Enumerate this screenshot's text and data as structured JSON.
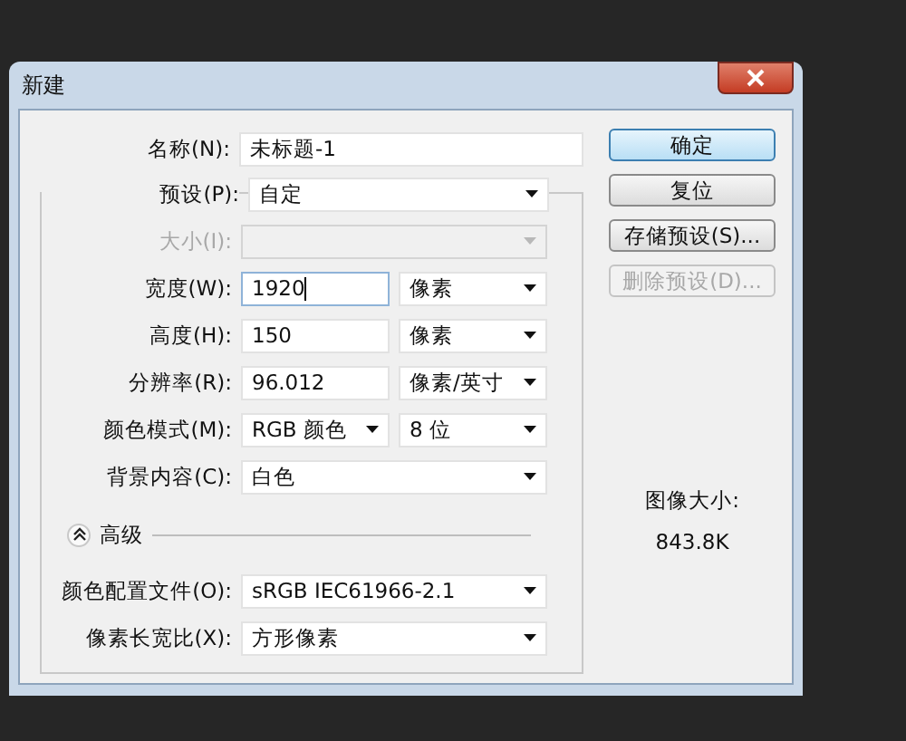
{
  "window": {
    "title": "新建"
  },
  "name": {
    "label": "名称(N):",
    "value": "未标题-1"
  },
  "preset": {
    "label": "预设(P):",
    "value": "自定"
  },
  "rows": [
    {
      "label": "大小(I):",
      "disabled": true,
      "controls": [
        {
          "kind": "select"
        }
      ]
    },
    {
      "label": "宽度(W):",
      "disabled": false,
      "controls": [
        {
          "kind": "text",
          "value": "1920",
          "focused": true
        },
        {
          "kind": "select",
          "value": "像素"
        }
      ]
    },
    {
      "label": "高度(H):",
      "disabled": false,
      "controls": [
        {
          "kind": "text",
          "value": "150",
          "focused": false
        },
        {
          "kind": "select",
          "value": "像素"
        }
      ]
    },
    {
      "label": "分辨率(R):",
      "disabled": false,
      "controls": [
        {
          "kind": "text",
          "value": "96.012",
          "focused": false
        },
        {
          "kind": "select",
          "value": "像素/英寸"
        }
      ]
    },
    {
      "label": "颜色模式(M):",
      "disabled": false,
      "controls": [
        {
          "kind": "select",
          "value": "RGB 颜色"
        },
        {
          "kind": "select",
          "value": "8 位"
        }
      ]
    },
    {
      "label": "背景内容(C):",
      "disabled": false,
      "controls": [
        {
          "kind": "select",
          "value": "白色"
        }
      ]
    }
  ],
  "advanced": {
    "label": "高级",
    "expanded": true,
    "rows": [
      {
        "label": "颜色配置文件(O):",
        "disabled": false,
        "controls": [
          {
            "kind": "select",
            "value": "sRGB IEC61966-2.1"
          }
        ]
      },
      {
        "label": "像素长宽比(X):",
        "disabled": false,
        "controls": [
          {
            "kind": "select",
            "value": "方形像素"
          }
        ]
      }
    ]
  },
  "buttons": [
    {
      "label": "确定",
      "default": true,
      "disabled": false
    },
    {
      "label": "复位",
      "default": false,
      "disabled": false
    },
    {
      "label": "存储预设(S)...",
      "default": false,
      "disabled": false
    },
    {
      "label": "删除预设(D)...",
      "default": false,
      "disabled": true
    }
  ],
  "image_size": {
    "label": "图像大小:",
    "value": "843.8K"
  }
}
